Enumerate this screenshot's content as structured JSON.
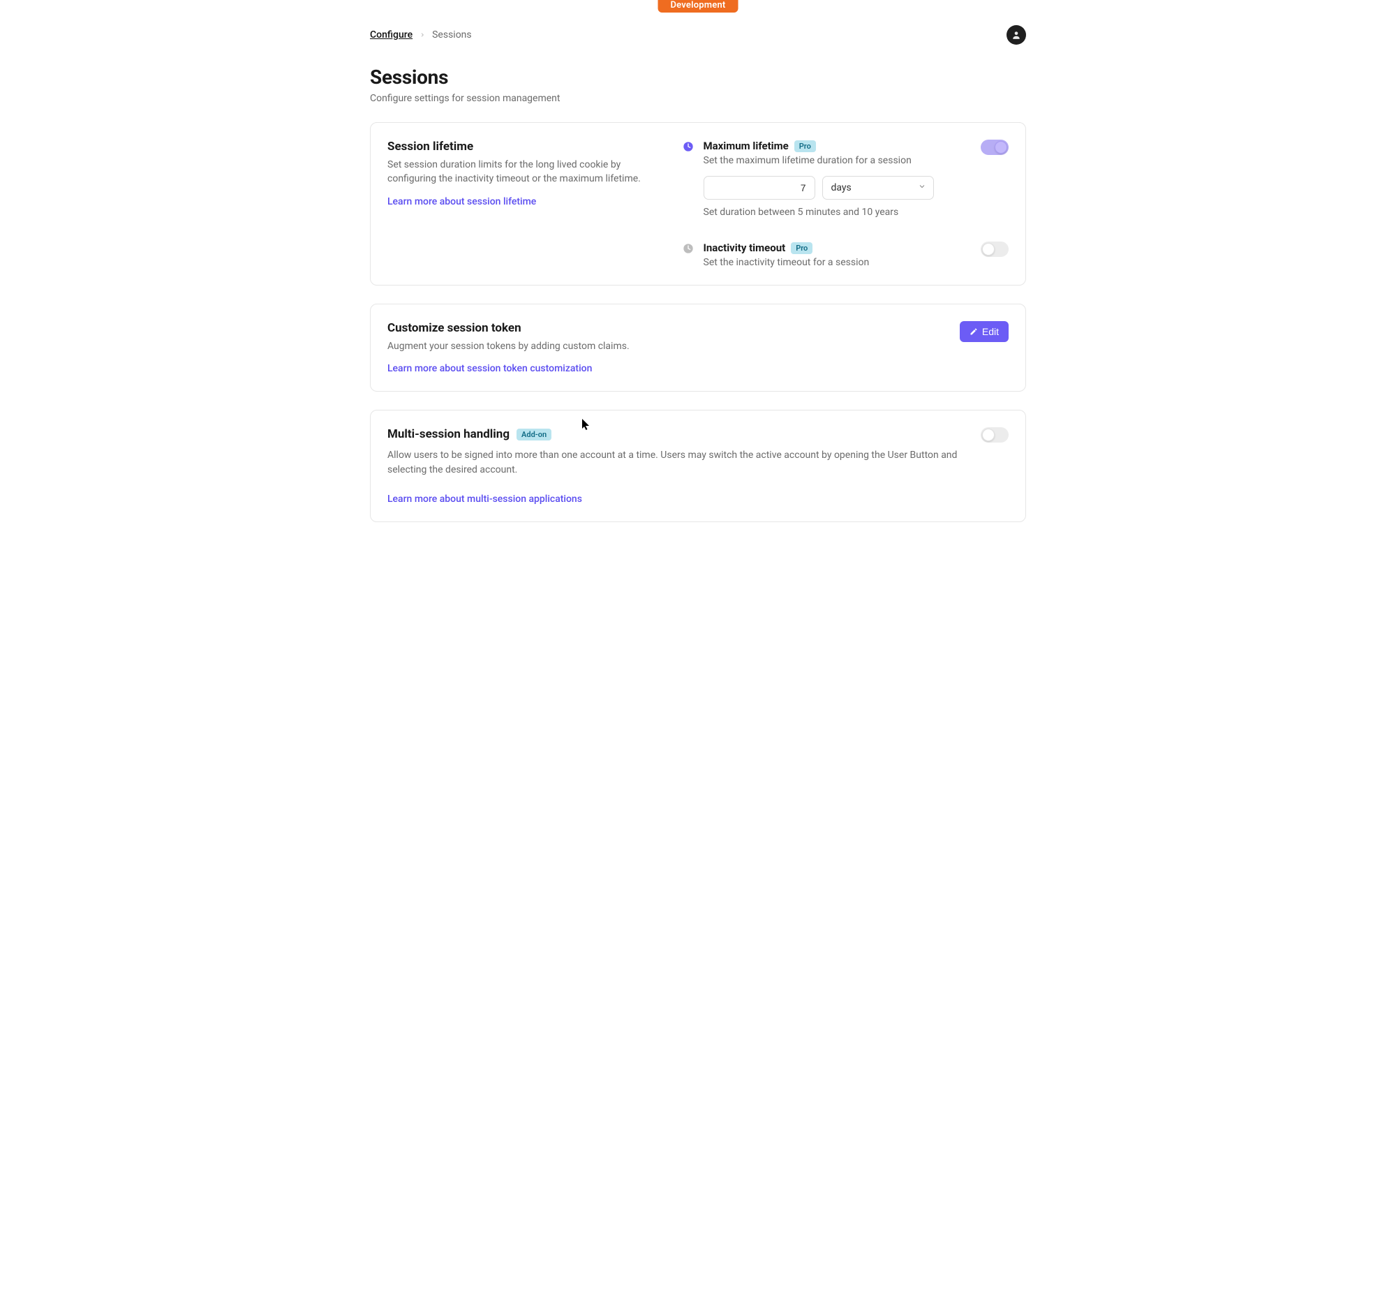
{
  "env_badge": "Development",
  "breadcrumb": {
    "first": "Configure",
    "current": "Sessions"
  },
  "page": {
    "title": "Sessions",
    "subtitle": "Configure settings for session management"
  },
  "session_lifetime": {
    "title": "Session lifetime",
    "desc": "Set session duration limits for the long lived cookie by configuring the inactivity timeout or the maximum lifetime.",
    "learn": "Learn more about session lifetime",
    "max": {
      "title": "Maximum lifetime",
      "badge": "Pro",
      "sub": "Set the maximum lifetime duration for a session",
      "value": "7",
      "unit": "days",
      "hint": "Set duration between 5 minutes and 10 years",
      "enabled": true
    },
    "inactivity": {
      "title": "Inactivity timeout",
      "badge": "Pro",
      "sub": "Set the inactivity timeout for a session",
      "enabled": false
    }
  },
  "custom_token": {
    "title": "Customize session token",
    "desc": "Augment your session tokens by adding custom claims.",
    "learn": "Learn more about session token customization",
    "edit_label": "Edit"
  },
  "multi_session": {
    "title": "Multi-session handling",
    "badge": "Add-on",
    "desc": "Allow users to be signed into more than one account at a time. Users may switch the active account by opening the User Button and selecting the desired account.",
    "learn": "Learn more about multi-session applications",
    "enabled": false
  }
}
